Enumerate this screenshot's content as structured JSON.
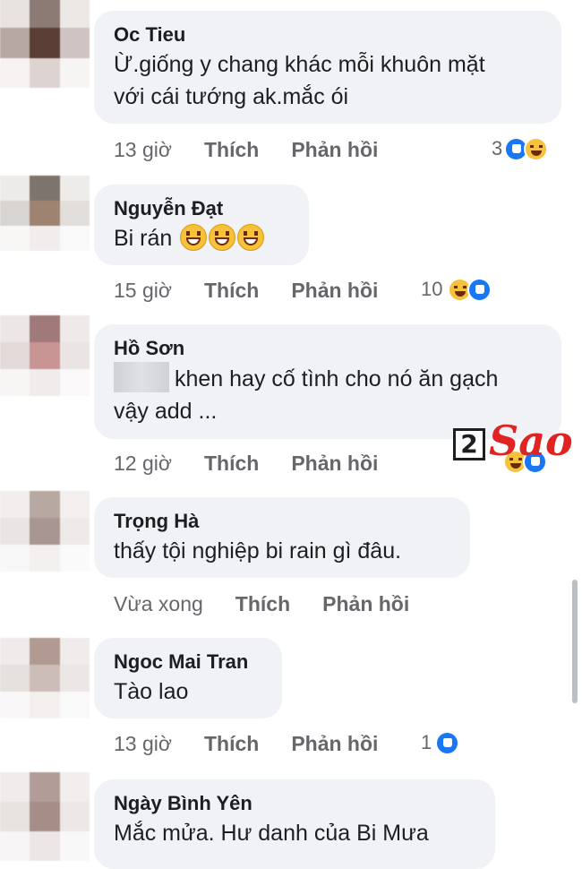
{
  "comments": [
    {
      "author": "Oc Tieu",
      "lines": [
        "Ừ.giống y chang khác mỗi khuôn mặt",
        "với cái tướng ak.mắc ói"
      ],
      "time": "13 giờ",
      "like_label": "Thích",
      "reply_label": "Phản hồi",
      "reaction_count": "3",
      "reaction_icons": [
        "like-icon",
        "haha-icon"
      ]
    },
    {
      "author": "Nguyễn Đạt",
      "text": "Bi rán",
      "inline_emoji": [
        "grinning-emoji",
        "grinning-emoji",
        "grinning-emoji"
      ],
      "time": "15 giờ",
      "like_label": "Thích",
      "reply_label": "Phản hồi",
      "reaction_count": "10",
      "reaction_icons": [
        "haha-icon",
        "like-icon"
      ]
    },
    {
      "author": "Hồ Sơn",
      "lines": [
        "khen hay cố tình cho nó ăn gạch",
        "vậy add ..."
      ],
      "time": "12 giờ",
      "like_label": "Thích",
      "reply_label": "Phản hồi",
      "reaction_count": "",
      "reaction_icons": [
        "haha-icon",
        "like-icon"
      ]
    },
    {
      "author": "Trọng Hà",
      "text": "thấy tội nghiệp bi rain gì đâu.",
      "time": "Vừa xong",
      "like_label": "Thích",
      "reply_label": "Phản hồi"
    },
    {
      "author": "Ngoc Mai Tran",
      "text": "Tào lao",
      "time": "13 giờ",
      "like_label": "Thích",
      "reply_label": "Phản hồi",
      "reaction_count": "1",
      "reaction_icons": [
        "like-icon"
      ]
    },
    {
      "author": "Ngày Bình Yên",
      "text": "Mắc mửa. Hư danh của Bi Mưa"
    }
  ],
  "watermark": {
    "digit": "2",
    "word": "Sao",
    "colors": {
      "digit": "#1c1e21",
      "word": "#e02424"
    }
  },
  "colors": {
    "bubble": "#f0f2f5",
    "meta_text": "#65676b",
    "like_blue": "#1877f2",
    "haha_yellow": "#f7c23b"
  }
}
